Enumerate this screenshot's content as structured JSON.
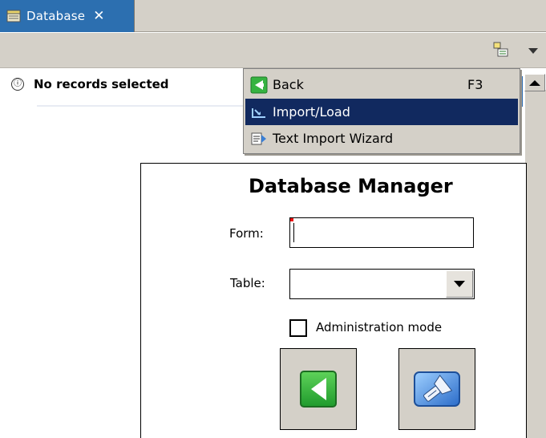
{
  "tab": {
    "label": "Database",
    "close": "✕",
    "icon": "database-icon"
  },
  "toolbar": {
    "icon": "grid-layout-icon",
    "menu": "view-menu-chevron"
  },
  "status": {
    "icon": "ⓘ",
    "text": "No records selected"
  },
  "menu": {
    "items": [
      {
        "label": "Back",
        "shortcut": "F3",
        "icon": "back-arrow-icon"
      },
      {
        "label": "Import/Load",
        "shortcut": "",
        "icon": "import-icon",
        "selected": true
      },
      {
        "label": "Text Import Wizard",
        "shortcut": "",
        "icon": "text-import-wizard-icon"
      }
    ]
  },
  "form": {
    "title": "Database Manager",
    "form_label": "Form:",
    "form_value": "",
    "table_label": "Table:",
    "table_value": "",
    "admin_label": "Administration mode",
    "admin_checked": false
  },
  "colors": {
    "tab_bg": "#2c6fb0",
    "chrome": "#d4d0c8",
    "selection": "#11295f",
    "back_green": "#2fae3a",
    "search_blue": "#3a7fd5"
  }
}
